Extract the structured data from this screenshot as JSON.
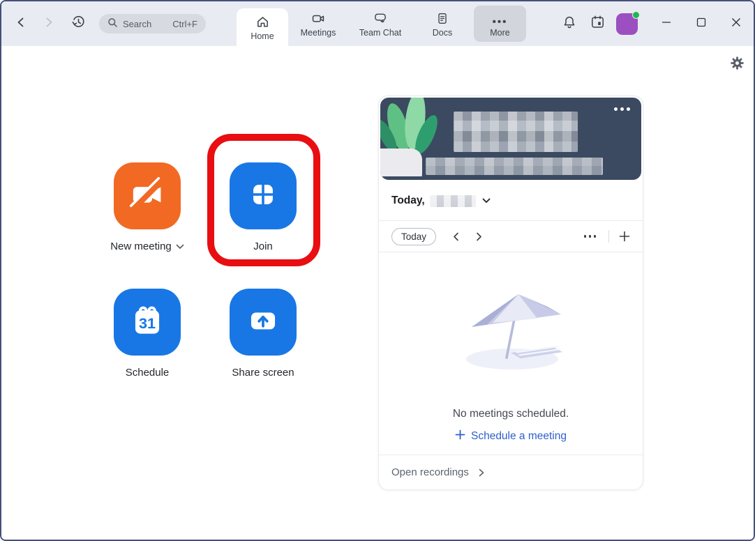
{
  "titlebar": {
    "search": {
      "placeholder": "Search",
      "shortcut": "Ctrl+F"
    },
    "tabs": [
      {
        "label": "Home",
        "active": true
      },
      {
        "label": "Meetings",
        "active": false
      },
      {
        "label": "Team Chat",
        "active": false
      },
      {
        "label": "Docs",
        "active": false
      },
      {
        "label": "More",
        "active": false
      }
    ]
  },
  "home": {
    "actions": [
      {
        "label": "New meeting",
        "color": "#F26924",
        "has_dropdown": true
      },
      {
        "label": "Join",
        "color": "#1877E5",
        "highlighted": true
      },
      {
        "label": "Schedule",
        "color": "#1877E5"
      },
      {
        "label": "Share screen",
        "color": "#1877E5"
      }
    ]
  },
  "panel": {
    "date_row": {
      "prefix": "Today,"
    },
    "toolbar": {
      "today": "Today"
    },
    "empty": {
      "message": "No meetings scheduled.",
      "cta": "Schedule a meeting"
    },
    "footer": {
      "label": "Open recordings"
    }
  },
  "colors": {
    "brand_blue": "#1877E5",
    "brand_orange": "#F26924",
    "highlight_red": "#E80E11",
    "banner_navy": "#3B4A60",
    "link_blue": "#2E5FCE",
    "avatar_purple": "#9B4FC0",
    "presence_green": "#1FB84E",
    "titlebar_bg": "#E9EBF3"
  }
}
